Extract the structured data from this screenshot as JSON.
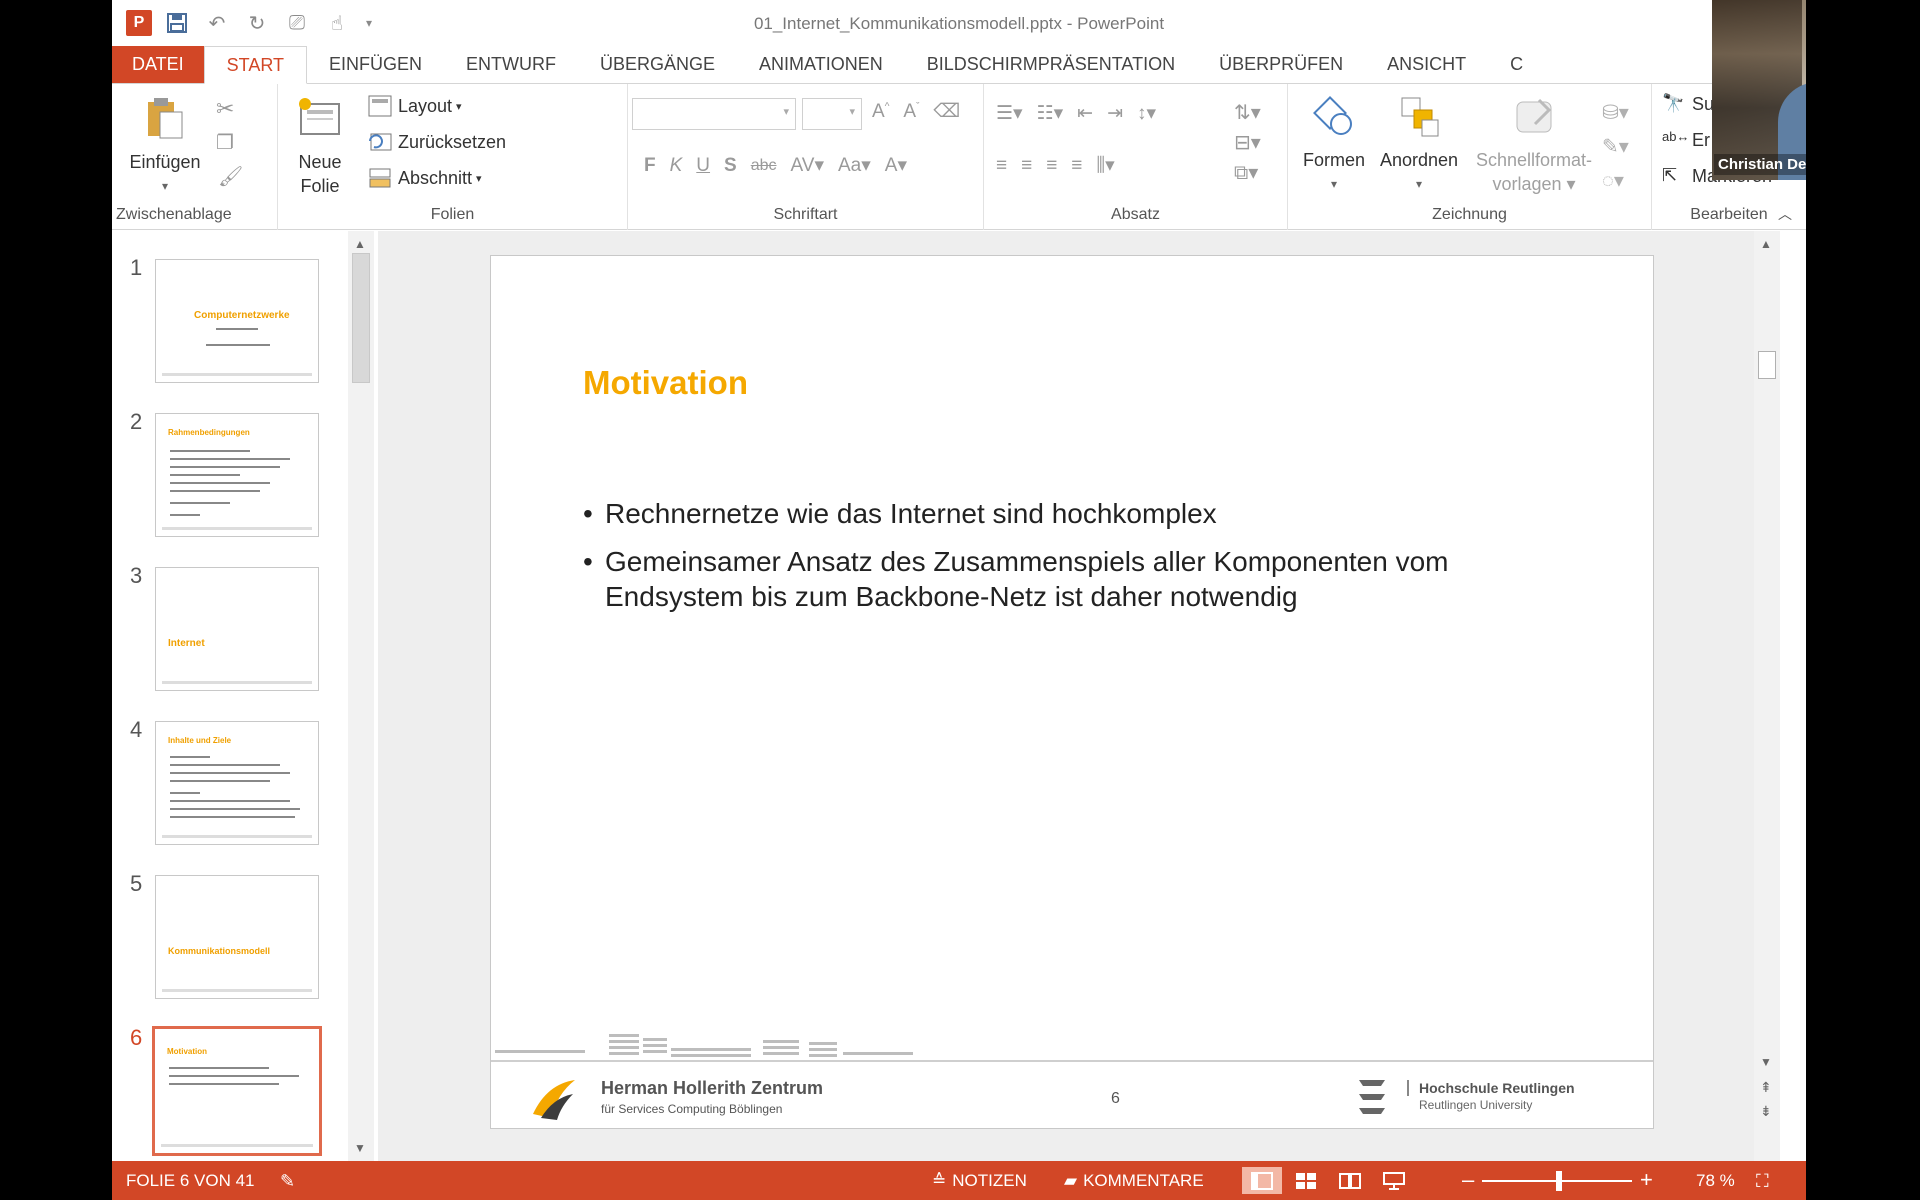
{
  "window": {
    "title": "01_Internet_Kommunikationsmodell.pptx - PowerPoint"
  },
  "ribbon_tabs": [
    {
      "label": "DATEI"
    },
    {
      "label": "START"
    },
    {
      "label": "EINFÜGEN"
    },
    {
      "label": "ENTWURF"
    },
    {
      "label": "ÜBERGÄNGE"
    },
    {
      "label": "ANIMATIONEN"
    },
    {
      "label": "BILDSCHIRMPRÄSENTATION"
    },
    {
      "label": "ÜBERPRÜFEN"
    },
    {
      "label": "ANSICHT"
    },
    {
      "label": "C"
    }
  ],
  "ribbon": {
    "clipboard": {
      "paste": "Einfügen",
      "group": "Zwischenablage"
    },
    "slides": {
      "new_slide_1": "Neue",
      "new_slide_2": "Folie",
      "layout": "Layout",
      "reset": "Zurücksetzen",
      "section": "Abschnitt",
      "group": "Folien"
    },
    "font": {
      "bold": "F",
      "italic": "K",
      "underline": "U",
      "shadow": "S",
      "strike": "abc",
      "case": "Aa",
      "group": "Schriftart"
    },
    "paragraph": {
      "group": "Absatz"
    },
    "drawing": {
      "shapes": "Formen",
      "arrange": "Anordnen",
      "quickstyles_1": "Schnellformat-",
      "quickstyles_2": "vorlagen",
      "group": "Zeichnung"
    },
    "editing": {
      "find": "Su",
      "replace": "Er",
      "select": "Markieren",
      "group": "Bearbeiten"
    }
  },
  "webcam": {
    "participant": "Christian Decker"
  },
  "thumbnails": [
    {
      "num": "1",
      "title": "Computernetzwerke"
    },
    {
      "num": "2",
      "title": "Rahmenbedingungen"
    },
    {
      "num": "3",
      "title": "Internet"
    },
    {
      "num": "4",
      "title": "Inhalte und Ziele"
    },
    {
      "num": "5",
      "title": "Kommunikationsmodell"
    },
    {
      "num": "6",
      "title": "Motivation"
    }
  ],
  "slide": {
    "title": "Motivation",
    "bullets": [
      "Rechnernetze wie das Internet sind hochkomplex",
      "Gemeinsamer Ansatz des Zusammenspiels aller Komponenten vom Endsystem bis zum Backbone-Netz ist daher notwendig"
    ],
    "bullet_char": "•",
    "page_number": "6",
    "footer_left_name": "Herman Hollerith Zentrum",
    "footer_left_sub": "für Services Computing Böblingen",
    "footer_right_name": "Hochschule Reutlingen",
    "footer_right_sub": "Reutlingen University"
  },
  "statusbar": {
    "slide_position": "FOLIE 6 VON 41",
    "notes": "NOTIZEN",
    "comments": "KOMMENTARE",
    "zoom_minus": "–",
    "zoom_plus": "+",
    "zoom": "78 %"
  },
  "colors": {
    "accent": "#d24726",
    "slide_title": "#f5a800"
  }
}
